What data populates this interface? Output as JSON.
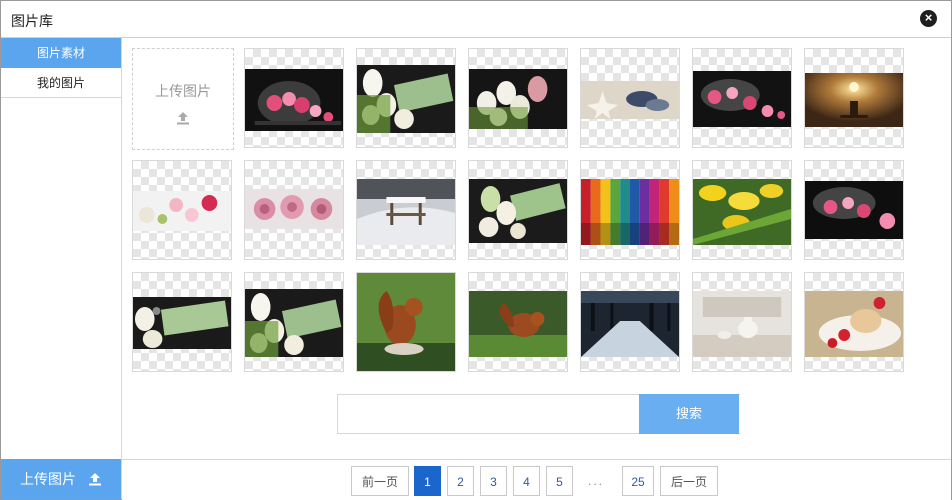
{
  "window": {
    "title": "图片库"
  },
  "sidebar": {
    "items": [
      {
        "label": "图片素材",
        "active": true
      },
      {
        "label": "我的图片",
        "active": false
      }
    ],
    "upload_label": "上传图片"
  },
  "grid": {
    "upload_label": "上传图片",
    "images": [
      {
        "name": "candy-jar"
      },
      {
        "name": "tulips-sweet-home"
      },
      {
        "name": "tulips-eggs"
      },
      {
        "name": "shells-beach"
      },
      {
        "name": "candy-jar-spill"
      },
      {
        "name": "lamp-room"
      },
      {
        "name": "flowers-row"
      },
      {
        "name": "roses"
      },
      {
        "name": "snow-bench"
      },
      {
        "name": "tulips-sweet-home-green"
      },
      {
        "name": "colorful-wood"
      },
      {
        "name": "yellow-tulips"
      },
      {
        "name": "candy-jar-dark"
      },
      {
        "name": "sweet-home-sign"
      },
      {
        "name": "tulips-sweet-home-2"
      },
      {
        "name": "red-squirrel"
      },
      {
        "name": "squirrel-grass"
      },
      {
        "name": "forest-road"
      },
      {
        "name": "tea-set"
      },
      {
        "name": "dessert-strawberry"
      }
    ]
  },
  "search": {
    "value": "",
    "placeholder": "",
    "button_label": "搜索"
  },
  "pagination": {
    "prev_label": "前一页",
    "next_label": "后一页",
    "pages": [
      "1",
      "2",
      "3",
      "4",
      "5"
    ],
    "ellipsis": "...",
    "last": "25",
    "current": "1"
  }
}
